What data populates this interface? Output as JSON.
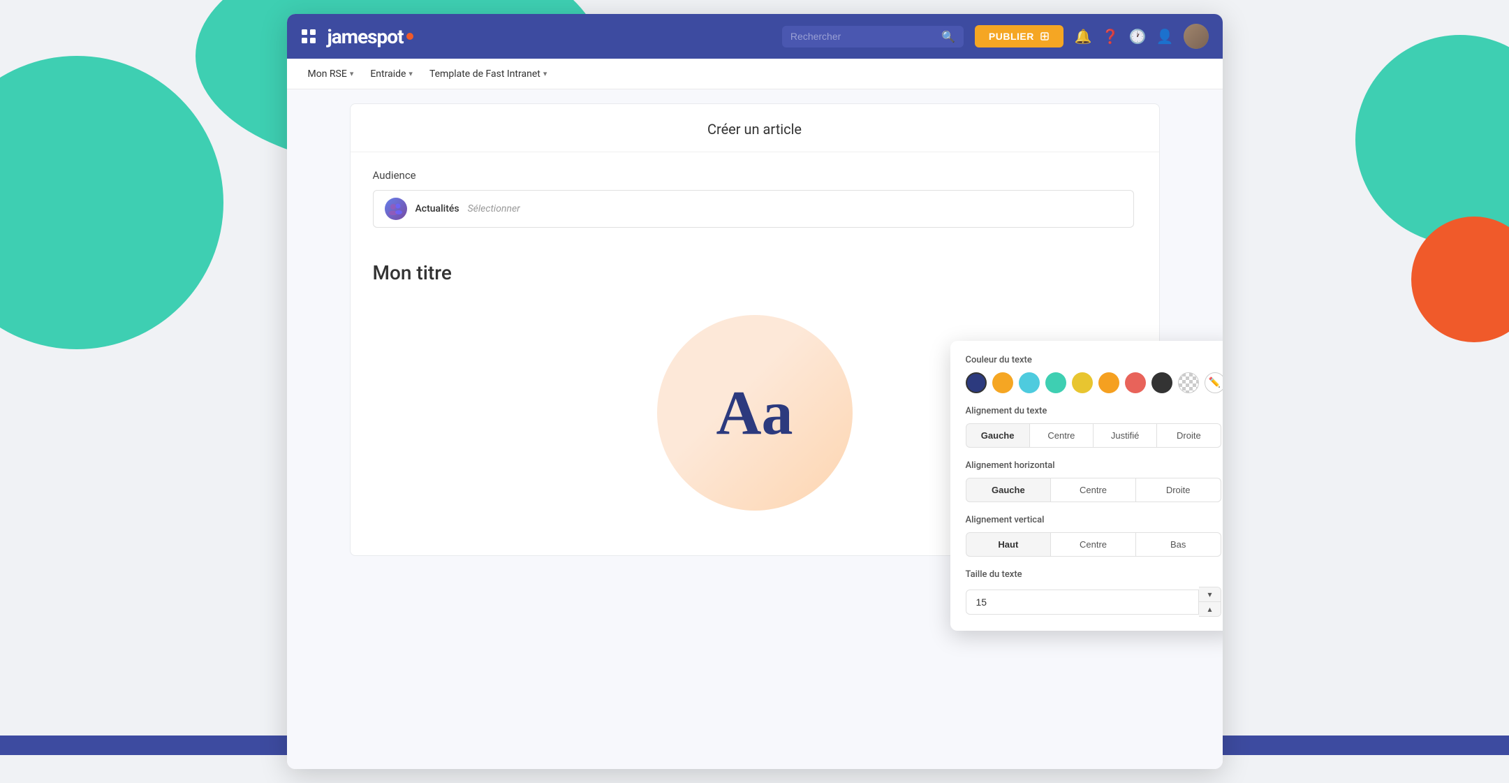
{
  "topbar": {
    "logo_text": "jamespot",
    "search_placeholder": "Rechercher",
    "publish_label": "PUBLIER"
  },
  "subnav": {
    "items": [
      {
        "label": "Mon RSE",
        "has_chevron": true
      },
      {
        "label": "Entraide",
        "has_chevron": true
      },
      {
        "label": "Template de Fast Intranet",
        "has_chevron": true
      }
    ]
  },
  "article": {
    "page_title": "Créer un article",
    "audience_label": "Audience",
    "audience_name": "Actualités",
    "audience_placeholder": "Sélectionner",
    "body_title": "Mon titre"
  },
  "color_panel": {
    "section_couleur": "Couleur du texte",
    "section_alignement_texte": "Alignement du texte",
    "section_alignement_horizontal": "Alignement horizontal",
    "section_alignement_vertical": "Alignement vertical",
    "section_taille": "Taille du texte",
    "colors": [
      {
        "name": "navy",
        "hex": "#2c3a7e"
      },
      {
        "name": "yellow",
        "hex": "#f5a623"
      },
      {
        "name": "cyan",
        "hex": "#4ecbde"
      },
      {
        "name": "teal",
        "hex": "#3ecfb2"
      },
      {
        "name": "gold",
        "hex": "#e8c530"
      },
      {
        "name": "orange",
        "hex": "#f5a020"
      },
      {
        "name": "coral",
        "hex": "#e8635a"
      },
      {
        "name": "dark",
        "hex": "#333333"
      }
    ],
    "align_texte_options": [
      "Gauche",
      "Centre",
      "Justifié",
      "Droite"
    ],
    "align_texte_active": "Gauche",
    "align_h_options": [
      "Gauche",
      "Centre",
      "Droite"
    ],
    "align_h_active": "Gauche",
    "align_v_options": [
      "Haut",
      "Centre",
      "Bas"
    ],
    "align_v_active": "Haut",
    "text_size": "15"
  }
}
